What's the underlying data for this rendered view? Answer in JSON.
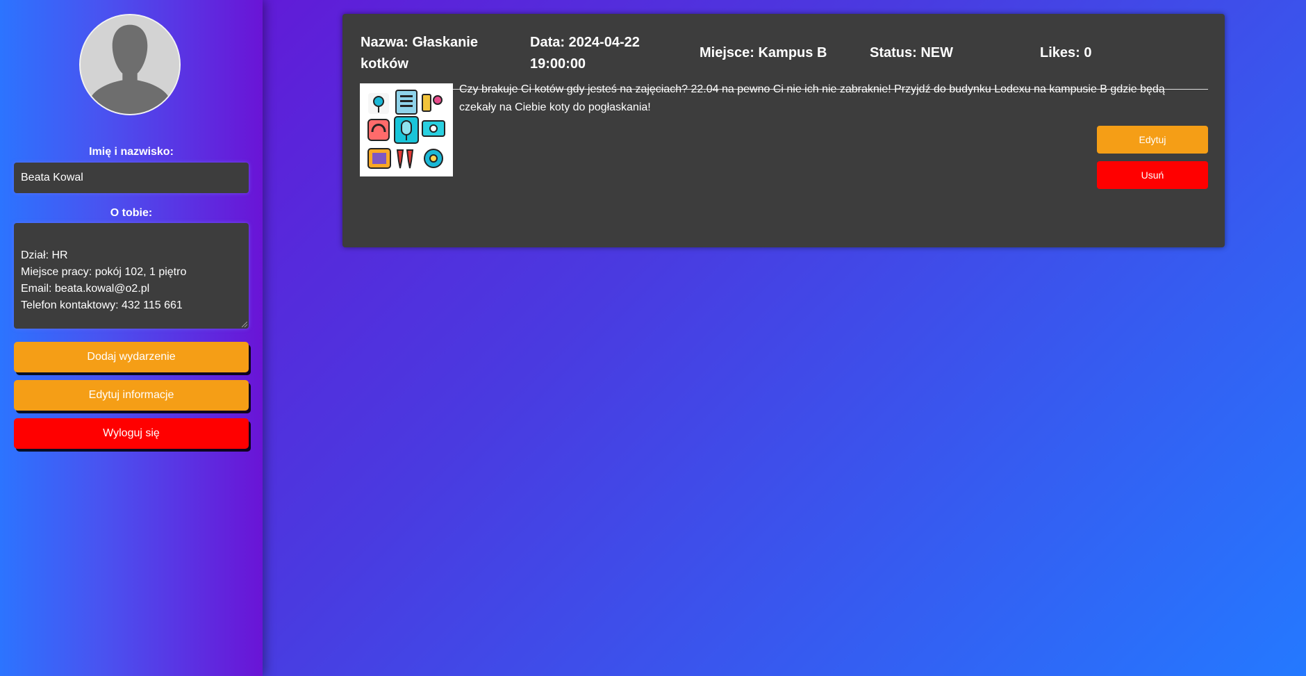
{
  "profile": {
    "name_label": "Imię i nazwisko:",
    "name_value": "Beata Kowal",
    "about_label": "O tobie:",
    "about_value": "Dział: HR\nMiejsce pracy: pokój 102, 1 piętro\nEmail: beata.kowal@o2.pl\nTelefon kontaktowy: 432 115 661",
    "avatar_icon": "default-user-silhouette-icon"
  },
  "sidebar": {
    "add_event_label": "Dodaj wydarzenie",
    "edit_info_label": "Edytuj informacje",
    "logout_label": "Wyloguj się"
  },
  "event": {
    "name": "Nazwa: Głaskanie kotków",
    "date": "Data: 2024-04-22 19:00:00",
    "place": "Miejsce: Kampus B",
    "status": "Status: NEW",
    "likes": "Likes: 0",
    "description": "Czy brakuje Ci kotów gdy jesteś na zajęciach? 22.04 na pewno Ci nie ich nie zabraknie! Przyjdź do budynku Lodexu na kampusie B gdzie będą czekały na Ciebie koty do pogłaskania!",
    "image_icon": "event-icons-grid",
    "edit_label": "Edytuj",
    "delete_label": "Usuń"
  },
  "colors": {
    "accent_orange": "#f59e16",
    "danger_red": "#ff0000",
    "card_bg": "#3d3d3d"
  }
}
